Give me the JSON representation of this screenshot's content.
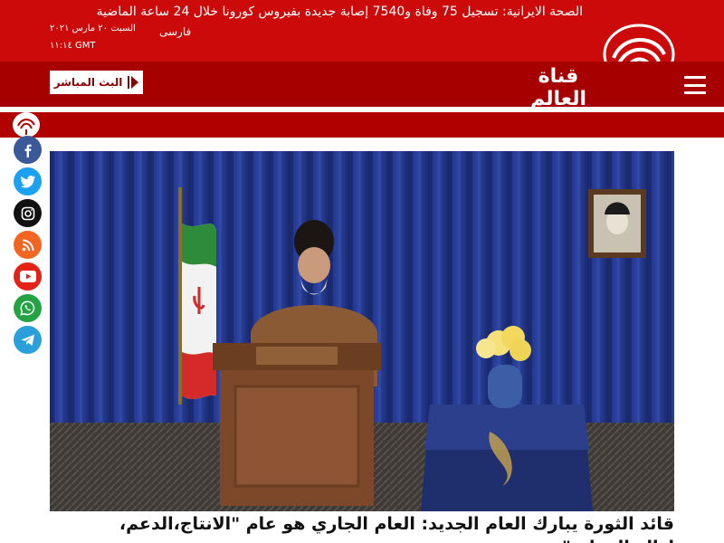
{
  "header": {
    "date": "السبت ٢٠ مارس ٢٠٢١",
    "time": "١١:١٤ GMT",
    "language_link": "فارسی",
    "live_button": "البث المباشر",
    "brand_name": "قناة العالم"
  },
  "ticker": {
    "text": "الصحة الايرانية: تسجيل 75 وفاة و7540 إصابة جديدة بفيروس كورونا خلال 24 ساعة الماضية"
  },
  "social_links": [
    {
      "icon": "facebook-icon",
      "color": "#3b5998"
    },
    {
      "icon": "twitter-icon",
      "color": "#1da1f2"
    },
    {
      "icon": "instagram-icon",
      "color": "#111111"
    },
    {
      "icon": "rss-icon",
      "color": "#f26522"
    },
    {
      "icon": "youtube-icon",
      "color": "#e62117"
    },
    {
      "icon": "whatsapp-icon",
      "color": "#25a244"
    },
    {
      "icon": "telegram-icon",
      "color": "#2b9fd9"
    }
  ],
  "article": {
    "headline_line1": "قائد الثورة يبارك العام الجديد: العام الجاري هو عام \"الانتاج،الدعم،",
    "headline_line2": "إزالة الموانع\""
  },
  "colors": {
    "header_red": "#cc0a0a",
    "nav_red": "#a60000",
    "ticker_red": "#b10000"
  }
}
